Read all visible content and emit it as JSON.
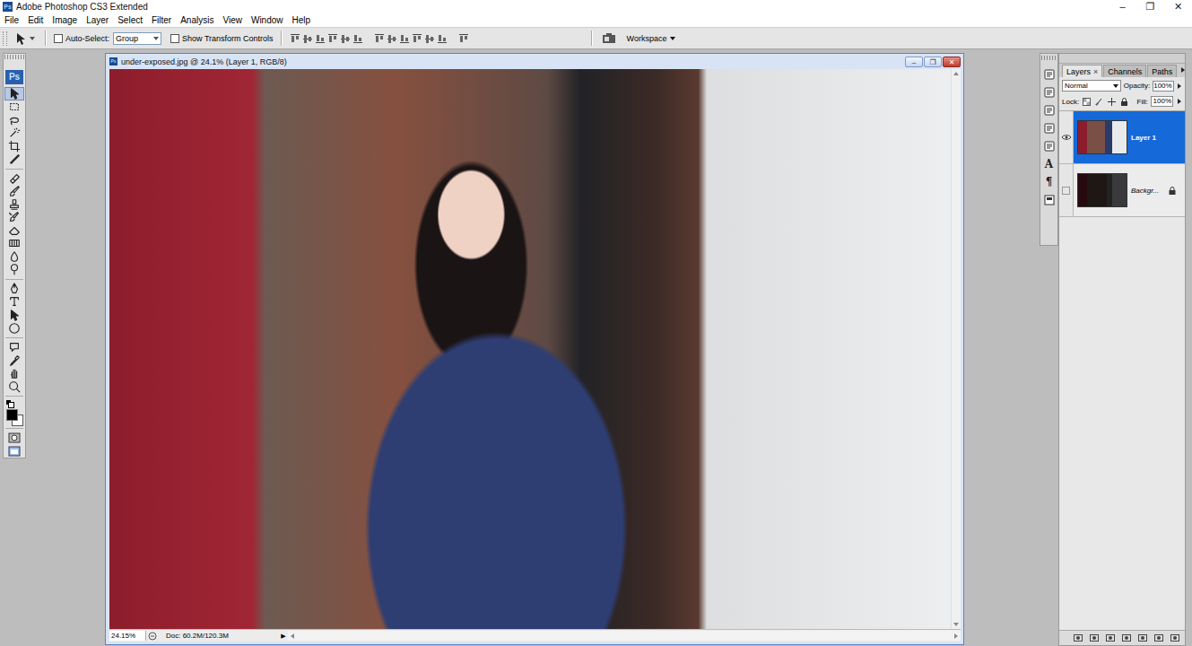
{
  "app": {
    "title": "Adobe Photoshop CS3 Extended",
    "logo": "Ps",
    "controls": [
      "–",
      "❐",
      "✕"
    ]
  },
  "menu": [
    "File",
    "Edit",
    "Image",
    "Layer",
    "Select",
    "Filter",
    "Analysis",
    "View",
    "Window",
    "Help"
  ],
  "options": {
    "auto_select": {
      "label": "Auto-Select:",
      "checked": false
    },
    "auto_select_mode": "Group",
    "show_transform": {
      "label": "Show Transform Controls",
      "checked": false
    },
    "workspace": "Workspace"
  },
  "toolbar": {
    "tools": [
      {
        "selected": true
      },
      {
        "selected": false
      },
      {
        "selected": false
      },
      {
        "selected": false
      },
      {
        "selected": false
      },
      {
        "selected": false
      },
      {
        "selected": false
      },
      {
        "selected": false
      },
      {
        "selected": false
      },
      {
        "selected": false
      },
      {
        "selected": false
      },
      {
        "selected": false
      },
      {
        "selected": false
      },
      {
        "selected": false
      },
      {
        "selected": false
      },
      {
        "selected": false
      },
      {
        "selected": false
      },
      {
        "selected": false
      },
      {
        "selected": false
      },
      {
        "selected": false
      },
      {
        "selected": false
      },
      {
        "selected": false
      }
    ],
    "foreground": "#000000",
    "background": "#ffffff"
  },
  "document": {
    "title": "under-exposed.jpg @ 24.1% (Layer 1, RGB/8)",
    "controls": [
      "–",
      "❐",
      "✕"
    ],
    "zoom": "24.15%",
    "doc_info": "Doc: 60.2M/120.3M",
    "info_arrow": "▶"
  },
  "dock_glyphs": [
    "A",
    "¶"
  ],
  "layers_panel": {
    "tabs": [
      {
        "label": "Layers",
        "selected": true,
        "close": "×"
      },
      {
        "label": "Channels",
        "selected": false
      },
      {
        "label": "Paths",
        "selected": false
      }
    ],
    "blend_mode": "Normal",
    "opacity_label": "Opacity:",
    "opacity": "100%",
    "lock_label": "Lock:",
    "fill_label": "Fill:",
    "fill": "100%",
    "layers": [
      {
        "name": "Layer 1",
        "selected": true,
        "visible": true,
        "locked": false
      },
      {
        "name": "Backgr...",
        "selected": false,
        "visible": false,
        "locked": true
      }
    ]
  }
}
